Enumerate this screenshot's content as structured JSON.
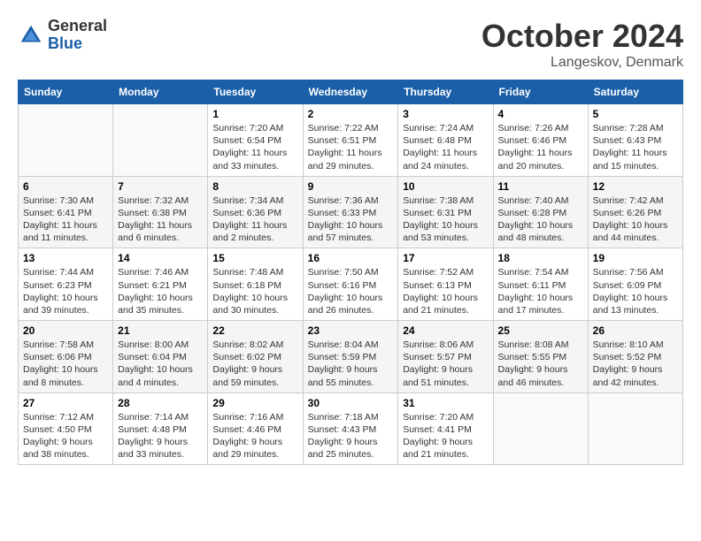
{
  "header": {
    "logo_general": "General",
    "logo_blue": "Blue",
    "month": "October 2024",
    "location": "Langeskov, Denmark"
  },
  "days_of_week": [
    "Sunday",
    "Monday",
    "Tuesday",
    "Wednesday",
    "Thursday",
    "Friday",
    "Saturday"
  ],
  "weeks": [
    [
      {
        "day": "",
        "info": ""
      },
      {
        "day": "",
        "info": ""
      },
      {
        "day": "1",
        "info": "Sunrise: 7:20 AM\nSunset: 6:54 PM\nDaylight: 11 hours\nand 33 minutes."
      },
      {
        "day": "2",
        "info": "Sunrise: 7:22 AM\nSunset: 6:51 PM\nDaylight: 11 hours\nand 29 minutes."
      },
      {
        "day": "3",
        "info": "Sunrise: 7:24 AM\nSunset: 6:48 PM\nDaylight: 11 hours\nand 24 minutes."
      },
      {
        "day": "4",
        "info": "Sunrise: 7:26 AM\nSunset: 6:46 PM\nDaylight: 11 hours\nand 20 minutes."
      },
      {
        "day": "5",
        "info": "Sunrise: 7:28 AM\nSunset: 6:43 PM\nDaylight: 11 hours\nand 15 minutes."
      }
    ],
    [
      {
        "day": "6",
        "info": "Sunrise: 7:30 AM\nSunset: 6:41 PM\nDaylight: 11 hours\nand 11 minutes."
      },
      {
        "day": "7",
        "info": "Sunrise: 7:32 AM\nSunset: 6:38 PM\nDaylight: 11 hours\nand 6 minutes."
      },
      {
        "day": "8",
        "info": "Sunrise: 7:34 AM\nSunset: 6:36 PM\nDaylight: 11 hours\nand 2 minutes."
      },
      {
        "day": "9",
        "info": "Sunrise: 7:36 AM\nSunset: 6:33 PM\nDaylight: 10 hours\nand 57 minutes."
      },
      {
        "day": "10",
        "info": "Sunrise: 7:38 AM\nSunset: 6:31 PM\nDaylight: 10 hours\nand 53 minutes."
      },
      {
        "day": "11",
        "info": "Sunrise: 7:40 AM\nSunset: 6:28 PM\nDaylight: 10 hours\nand 48 minutes."
      },
      {
        "day": "12",
        "info": "Sunrise: 7:42 AM\nSunset: 6:26 PM\nDaylight: 10 hours\nand 44 minutes."
      }
    ],
    [
      {
        "day": "13",
        "info": "Sunrise: 7:44 AM\nSunset: 6:23 PM\nDaylight: 10 hours\nand 39 minutes."
      },
      {
        "day": "14",
        "info": "Sunrise: 7:46 AM\nSunset: 6:21 PM\nDaylight: 10 hours\nand 35 minutes."
      },
      {
        "day": "15",
        "info": "Sunrise: 7:48 AM\nSunset: 6:18 PM\nDaylight: 10 hours\nand 30 minutes."
      },
      {
        "day": "16",
        "info": "Sunrise: 7:50 AM\nSunset: 6:16 PM\nDaylight: 10 hours\nand 26 minutes."
      },
      {
        "day": "17",
        "info": "Sunrise: 7:52 AM\nSunset: 6:13 PM\nDaylight: 10 hours\nand 21 minutes."
      },
      {
        "day": "18",
        "info": "Sunrise: 7:54 AM\nSunset: 6:11 PM\nDaylight: 10 hours\nand 17 minutes."
      },
      {
        "day": "19",
        "info": "Sunrise: 7:56 AM\nSunset: 6:09 PM\nDaylight: 10 hours\nand 13 minutes."
      }
    ],
    [
      {
        "day": "20",
        "info": "Sunrise: 7:58 AM\nSunset: 6:06 PM\nDaylight: 10 hours\nand 8 minutes."
      },
      {
        "day": "21",
        "info": "Sunrise: 8:00 AM\nSunset: 6:04 PM\nDaylight: 10 hours\nand 4 minutes."
      },
      {
        "day": "22",
        "info": "Sunrise: 8:02 AM\nSunset: 6:02 PM\nDaylight: 9 hours\nand 59 minutes."
      },
      {
        "day": "23",
        "info": "Sunrise: 8:04 AM\nSunset: 5:59 PM\nDaylight: 9 hours\nand 55 minutes."
      },
      {
        "day": "24",
        "info": "Sunrise: 8:06 AM\nSunset: 5:57 PM\nDaylight: 9 hours\nand 51 minutes."
      },
      {
        "day": "25",
        "info": "Sunrise: 8:08 AM\nSunset: 5:55 PM\nDaylight: 9 hours\nand 46 minutes."
      },
      {
        "day": "26",
        "info": "Sunrise: 8:10 AM\nSunset: 5:52 PM\nDaylight: 9 hours\nand 42 minutes."
      }
    ],
    [
      {
        "day": "27",
        "info": "Sunrise: 7:12 AM\nSunset: 4:50 PM\nDaylight: 9 hours\nand 38 minutes."
      },
      {
        "day": "28",
        "info": "Sunrise: 7:14 AM\nSunset: 4:48 PM\nDaylight: 9 hours\nand 33 minutes."
      },
      {
        "day": "29",
        "info": "Sunrise: 7:16 AM\nSunset: 4:46 PM\nDaylight: 9 hours\nand 29 minutes."
      },
      {
        "day": "30",
        "info": "Sunrise: 7:18 AM\nSunset: 4:43 PM\nDaylight: 9 hours\nand 25 minutes."
      },
      {
        "day": "31",
        "info": "Sunrise: 7:20 AM\nSunset: 4:41 PM\nDaylight: 9 hours\nand 21 minutes."
      },
      {
        "day": "",
        "info": ""
      },
      {
        "day": "",
        "info": ""
      }
    ]
  ]
}
